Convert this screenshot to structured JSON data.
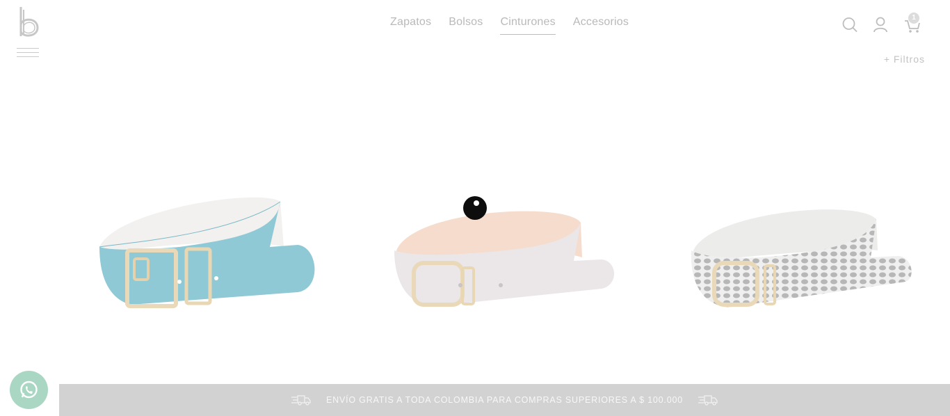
{
  "header": {
    "logo_icon": "b-logo-icon",
    "menu_icon": "hamburger-icon",
    "nav": [
      {
        "label": "Zapatos",
        "active": false
      },
      {
        "label": "Bolsos",
        "active": false
      },
      {
        "label": "Cinturones",
        "active": true
      },
      {
        "label": "Accesorios",
        "active": false
      }
    ],
    "search_icon": "search-icon",
    "account_icon": "user-icon",
    "cart_icon": "cart-icon",
    "cart_count": "1"
  },
  "filters_label": "+ Filtros",
  "products": [
    {
      "name": "belt-light-blue",
      "strap_color": "#8fc9d6"
    },
    {
      "name": "belt-light-gray",
      "strap_color": "#ece8ea"
    },
    {
      "name": "belt-snake-print",
      "strap_color": "#d9d9d9"
    }
  ],
  "whatsapp_icon": "whatsapp-icon",
  "shipping_banner": {
    "text": "ENVÍO GRATIS A TODA COLOMBIA PARA COMPRAS SUPERIORES A $ 100.000",
    "icon": "delivery-truck-icon"
  },
  "colors": {
    "banner_bg": "#d2d2d2",
    "whatsapp_bg": "#aad7c3",
    "nav_text": "#b9b9b9"
  }
}
